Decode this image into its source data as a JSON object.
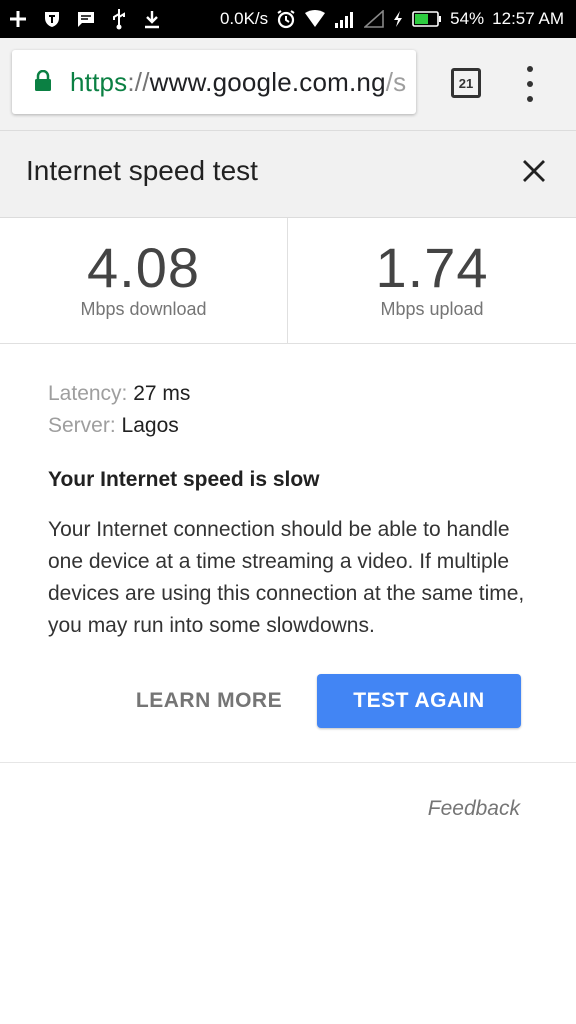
{
  "status_bar": {
    "network_speed": "0.0K/s",
    "battery_percent": "54%",
    "time": "12:57 AM",
    "icons_left": [
      "add-icon",
      "shield-icon",
      "message-icon",
      "usb-icon",
      "download-icon"
    ],
    "icons_right": [
      "alarm-icon",
      "wifi-icon",
      "signal-icon",
      "signal-empty-icon",
      "charging-icon",
      "battery-icon"
    ]
  },
  "browser": {
    "url_scheme": "https",
    "url_separator": "://",
    "url_host": "www.google.com.ng",
    "url_rest": "/s",
    "tab_count": "21",
    "lock_color": "#0b8043"
  },
  "card": {
    "title": "Internet speed test"
  },
  "results": {
    "download_value": "4.08",
    "download_label": "Mbps download",
    "upload_value": "1.74",
    "upload_label": "Mbps upload"
  },
  "details": {
    "latency_label": "Latency:",
    "latency_value": "27 ms",
    "server_label": "Server:",
    "server_value": "Lagos"
  },
  "verdict": "Your Internet speed is slow",
  "description": "Your Internet connection should be able to handle one device at a time streaming a video. If multiple devices are using this connection at the same time, you may run into some slowdowns.",
  "actions": {
    "learn_more": "LEARN MORE",
    "test_again": "TEST AGAIN",
    "primary_color": "#4285f4"
  },
  "feedback": "Feedback"
}
